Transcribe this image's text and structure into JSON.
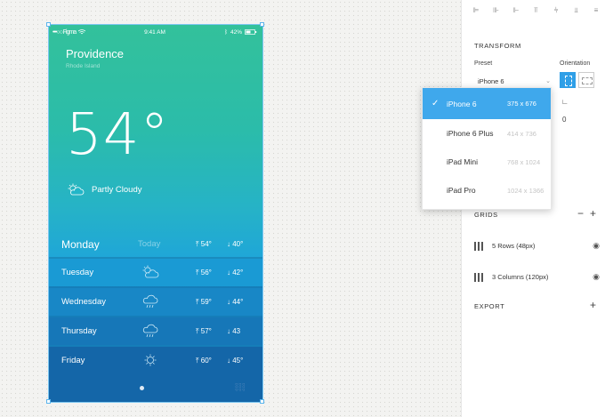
{
  "status_bar": {
    "carrier": "•••○○ Figma",
    "time": "9:41 AM",
    "battery": "42%"
  },
  "weather": {
    "city": "Providence",
    "region": "Rhode Island",
    "temperature": "54°",
    "condition": "Partly Cloudy",
    "days": [
      {
        "day": "Monday",
        "today": "Today",
        "high": "54°",
        "low": "40°",
        "icon": "none"
      },
      {
        "day": "Tuesday",
        "high": "56°",
        "low": "42°",
        "icon": "partly-cloudy-icon"
      },
      {
        "day": "Wednesday",
        "high": "59°",
        "low": "44°",
        "icon": "rain-cloud-icon"
      },
      {
        "day": "Thursday",
        "high": "57°",
        "low": "43",
        "icon": "rain-cloud-icon"
      },
      {
        "day": "Friday",
        "high": "60°",
        "low": "45°",
        "icon": "sun-icon"
      }
    ]
  },
  "panel": {
    "transform_title": "TRANSFORM",
    "preset_label": "Preset",
    "preset_value": "iPhone 6",
    "orientation_label": "Orientation",
    "rotation_value": "0",
    "grids_title": "GRIDS",
    "grids": [
      "5 Rows (48px)",
      "3 Columns (120px)"
    ],
    "export_title": "EXPORT"
  },
  "dropdown": {
    "options": [
      {
        "name": "iPhone 6",
        "size": "375 x 676",
        "selected": true
      },
      {
        "name": "iPhone 6 Plus",
        "size": "414 x 736",
        "selected": false
      },
      {
        "name": "iPad Mini",
        "size": "768 x 1024",
        "selected": false
      },
      {
        "name": "iPad Pro",
        "size": "1024 x 1366",
        "selected": false
      }
    ]
  },
  "colors": {
    "accent": "#3fa8ec",
    "weather_top": "#33c19b",
    "weather_bottom": "#1466a8"
  }
}
